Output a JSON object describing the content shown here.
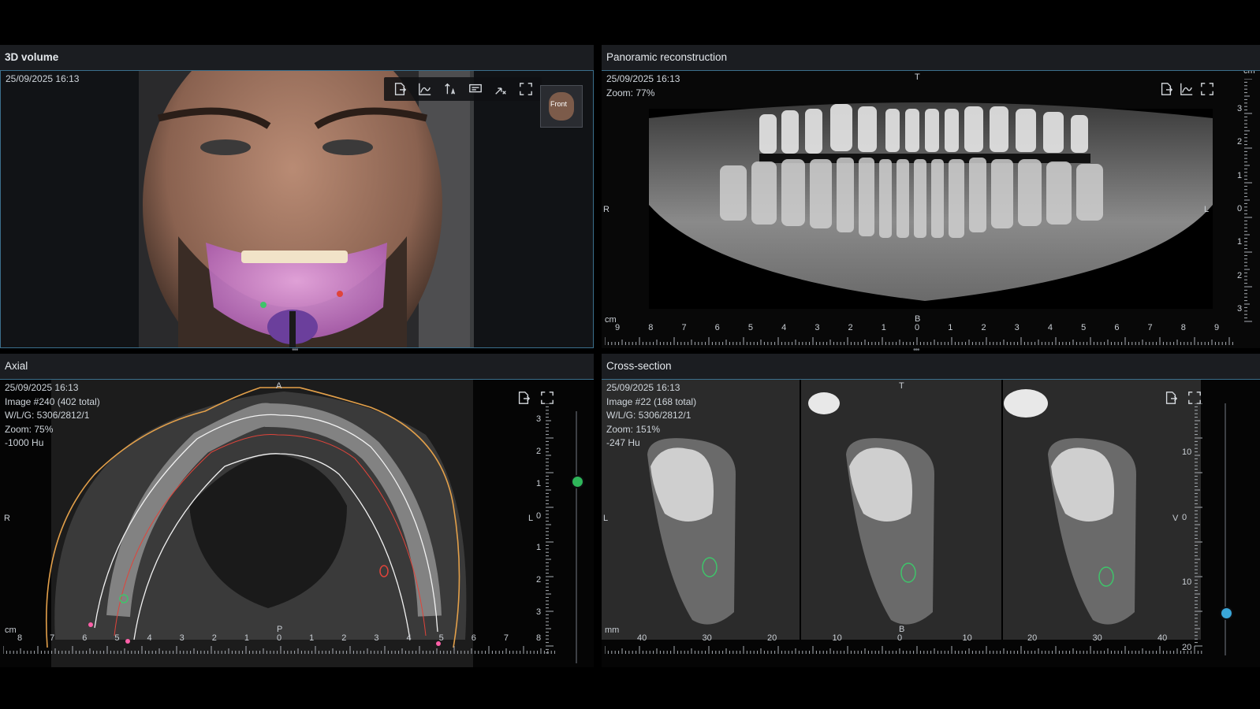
{
  "panes": {
    "volume3d": {
      "title": "3D volume",
      "timestamp": "25/09/2025 16:13",
      "orientation_cube_label": "Front"
    },
    "panoramic": {
      "title": "Panoramic reconstruction",
      "timestamp": "25/09/2025 16:13",
      "zoom": "Zoom: 77%",
      "orient_top": "T",
      "orient_left": "R",
      "orient_right": "L",
      "orient_bottom": "B",
      "unit": "cm",
      "x_ticks": [
        "9",
        "8",
        "7",
        "6",
        "5",
        "4",
        "3",
        "2",
        "1",
        "0",
        "1",
        "2",
        "3",
        "4",
        "5",
        "6",
        "7",
        "8",
        "9"
      ],
      "y_ticks": [
        "3",
        "2",
        "1",
        "0",
        "1",
        "2",
        "3"
      ]
    },
    "axial": {
      "title": "Axial",
      "timestamp": "25/09/2025 16:13",
      "image": "Image #240 (402 total)",
      "wl": "W/L/G: 5306/2812/1",
      "zoom": "Zoom: 75%",
      "hu": "-1000 Hu",
      "orient_top": "A",
      "orient_left": "R",
      "orient_right": "L",
      "orient_bottom": "P",
      "unit": "cm",
      "x_ticks": [
        "8",
        "7",
        "6",
        "5",
        "4",
        "3",
        "2",
        "1",
        "0",
        "1",
        "2",
        "3",
        "4",
        "5",
        "6",
        "7",
        "8"
      ],
      "y_ticks": [
        "3",
        "2",
        "1",
        "0",
        "1",
        "2",
        "3"
      ]
    },
    "cross": {
      "title": "Cross-section",
      "timestamp": "25/09/2025 16:13",
      "image": "Image #22 (168 total)",
      "wl": "W/L/G: 5306/2812/1",
      "zoom": "Zoom: 151%",
      "hu": "-247 Hu",
      "orient_top": "T",
      "orient_left": "L",
      "orient_right": "V",
      "orient_bottom": "B",
      "unit": "mm",
      "x_ticks": [
        "40",
        "30",
        "20",
        "10",
        "0",
        "10",
        "20",
        "30",
        "40"
      ],
      "y_ticks": [
        "10",
        "0",
        "10",
        "20"
      ]
    }
  },
  "colors": {
    "header_border": "#3b6f8c",
    "nerve_green": "#3fc46a",
    "nerve_red": "#e0443a",
    "arch_orange": "#e3a04a",
    "slider_green": "#2fb65a",
    "slider_blue": "#3aa6d8"
  }
}
